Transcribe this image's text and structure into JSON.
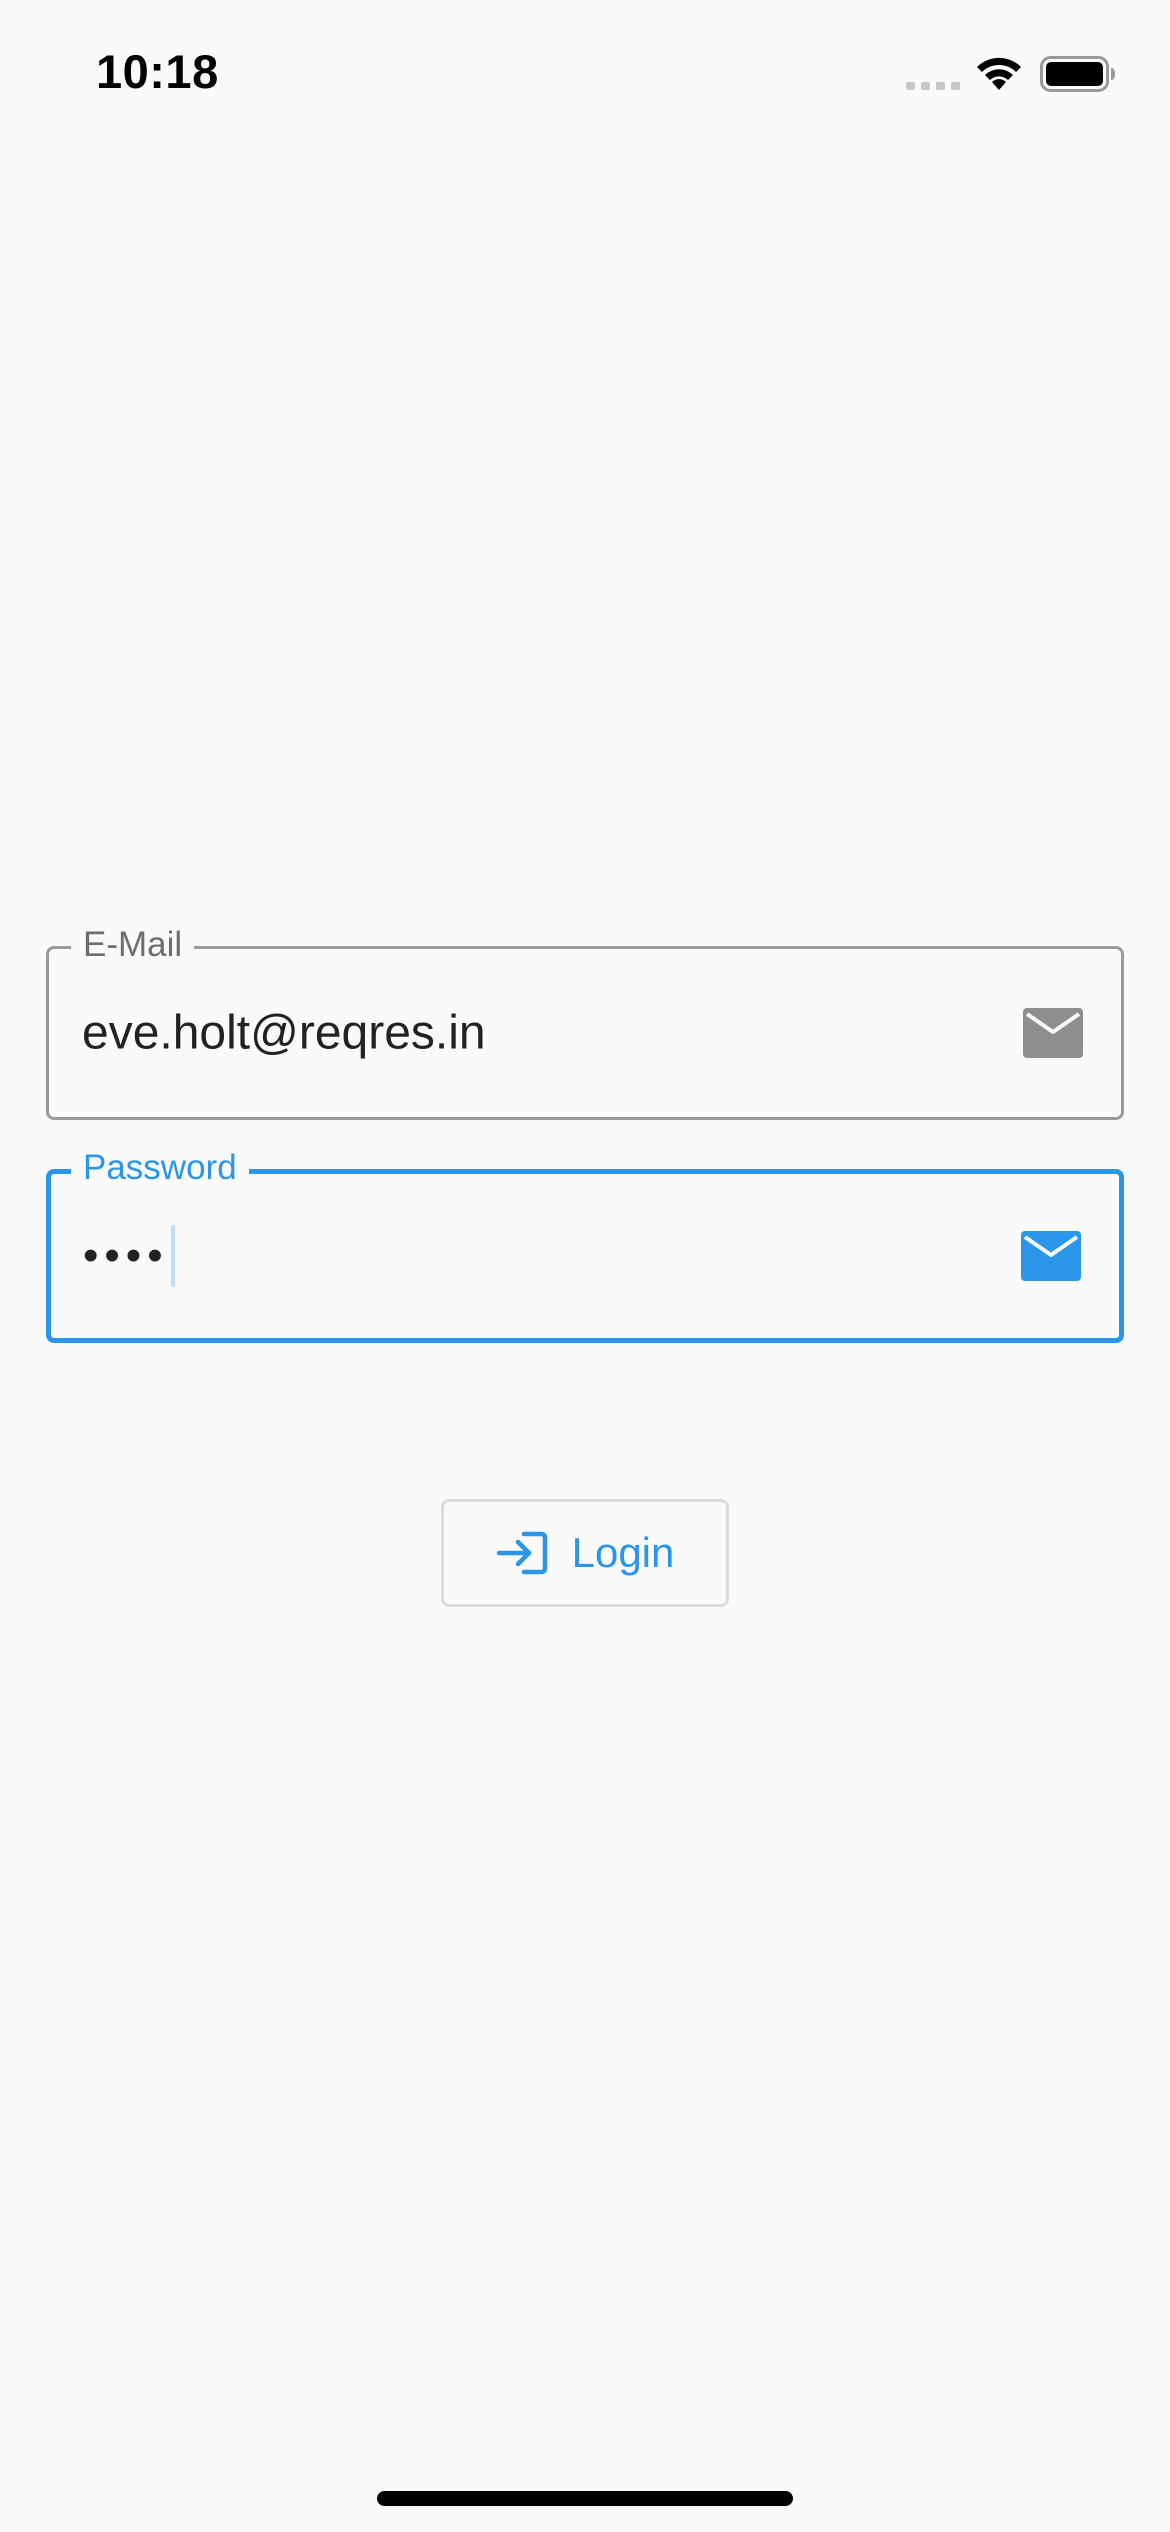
{
  "status_bar": {
    "time": "10:18"
  },
  "form": {
    "email": {
      "label": "E-Mail",
      "value": "eve.holt@reqres.in",
      "icon": "mail-icon"
    },
    "password": {
      "label": "Password",
      "masked_value": "••••",
      "icon": "mail-icon"
    }
  },
  "login_button": {
    "label": "Login",
    "icon": "login-icon"
  },
  "colors": {
    "accent": "#2a96ea",
    "border_inactive": "#9b9b9b",
    "icon_inactive": "#8e8e8e",
    "background": "#fafafa"
  }
}
